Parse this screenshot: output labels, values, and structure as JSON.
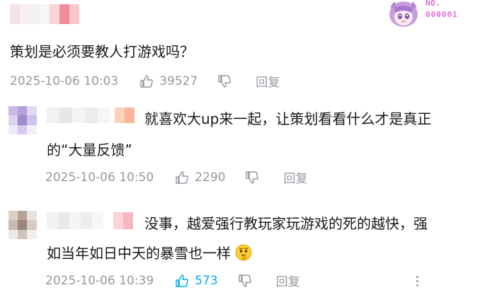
{
  "badge": {
    "no": "NO.",
    "number": "000001"
  },
  "main_comment": {
    "text": "策划是必须要教人打游戏吗？",
    "timestamp": "2025-10-06 10:03",
    "likes": "39527",
    "reply_label": "回复"
  },
  "replies": [
    {
      "line1": "就喜欢大up来一起，让策划看看什么才是真正",
      "line2": "的“大量反馈”",
      "timestamp": "2025-10-06 10:50",
      "likes": "2290",
      "reply_label": "回复",
      "liked": false
    },
    {
      "line1": "没事，越爱强行教玩家玩游戏的死的越快，强",
      "line2": "如当年如日中天的暴雪也一样",
      "timestamp": "2025-10-06 10:39",
      "likes": "573",
      "reply_label": "回复",
      "liked": true
    }
  ],
  "icons": {
    "like": "thumbs-up-icon",
    "dislike": "thumbs-down-icon",
    "emoji": "thinking-face-emoji",
    "more": "more-vertical-icon"
  },
  "colors": {
    "text": "#18191c",
    "meta": "#9499a0",
    "liked": "#00aeec",
    "badge": "#e76bd8"
  }
}
